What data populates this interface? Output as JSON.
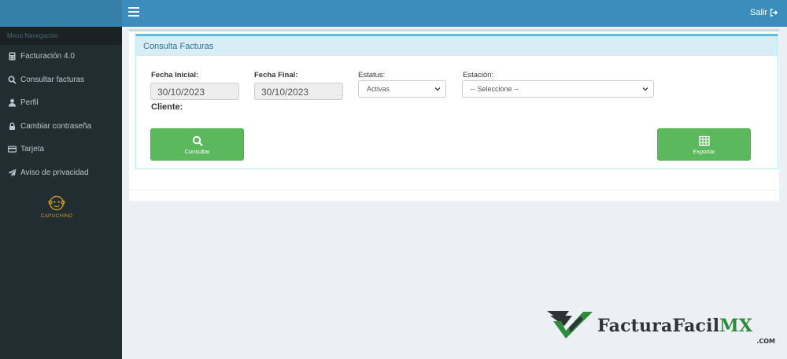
{
  "header": {
    "logout_label": "Salir"
  },
  "sidebar": {
    "title": "Menú Navegación",
    "items": [
      {
        "label": "Facturación 4.0",
        "icon": "calculator-icon"
      },
      {
        "label": "Consultar facturas",
        "icon": "search-icon"
      },
      {
        "label": "Perfil",
        "icon": "user-icon"
      },
      {
        "label": "Cambiar contraseña",
        "icon": "lock-icon"
      },
      {
        "label": "Tarjeta",
        "icon": "credit-card-icon"
      },
      {
        "label": "Aviso de privacidad",
        "icon": "paper-plane-icon"
      }
    ],
    "logo_text": "CAPUCHINO"
  },
  "panel": {
    "title": "Consulta Facturas",
    "fecha_inicial_label": "Fecha Inicial:",
    "fecha_inicial_value": "30/10/2023",
    "fecha_final_label": "Fecha Final:",
    "fecha_final_value": "30/10/2023",
    "estatus_label": "Estatus:",
    "estatus_value": "Activas",
    "estacion_label": "Estación:",
    "estacion_value": "-- Seleccione --",
    "cliente_label": "Cliente:",
    "consultar_label": "Consultar",
    "exportar_label": "Exportar"
  },
  "watermark": {
    "brand": "FacturaFacil",
    "brand_accent": "MX",
    "suffix": ".COM"
  },
  "colors": {
    "topbar": "#3c8dbc",
    "sidebar": "#222d32",
    "button": "#5cb85c",
    "panel_heading": "#d9edf7"
  }
}
